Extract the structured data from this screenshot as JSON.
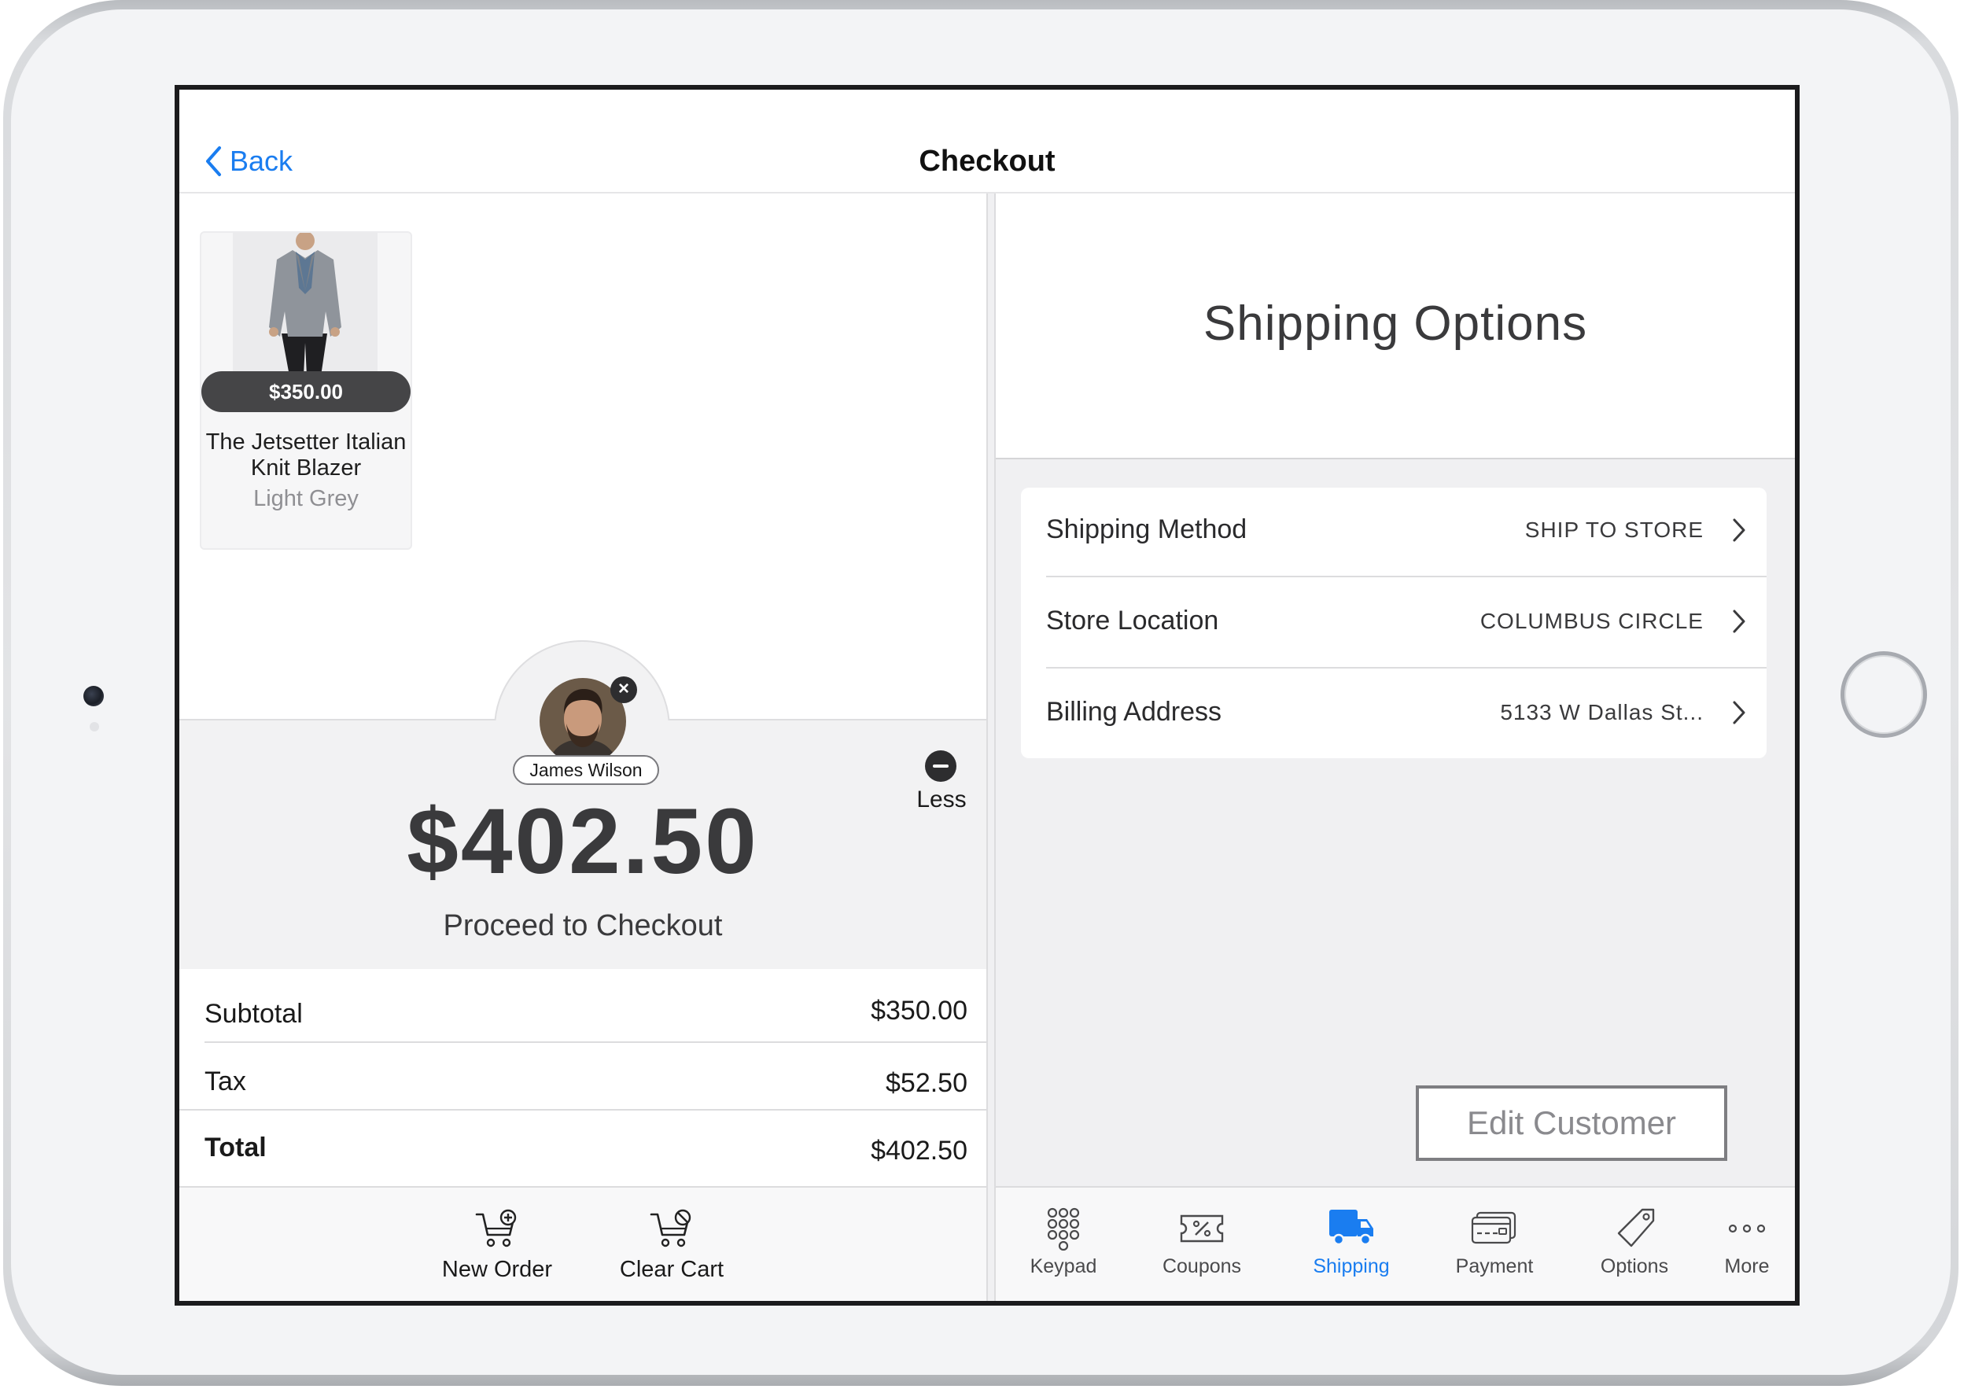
{
  "nav": {
    "back_label": "Back",
    "title": "Checkout"
  },
  "cart": {
    "items": [
      {
        "price": "$350.00",
        "name": "The Jetsetter Italian Knit Blazer",
        "variant": "Light Grey"
      }
    ]
  },
  "customer": {
    "name": "James Wilson"
  },
  "checkout": {
    "less_label": "Less",
    "total": "$402.50",
    "proceed_label": "Proceed to Checkout"
  },
  "summary": {
    "subtotal_label": "Subtotal",
    "subtotal_value": "$350.00",
    "tax_label": "Tax",
    "tax_value": "$52.50",
    "total_label": "Total",
    "total_value": "$402.50"
  },
  "left_tabs": [
    {
      "label": "New Order",
      "icon": "cart-add-icon"
    },
    {
      "label": "Clear Cart",
      "icon": "cart-clear-icon"
    }
  ],
  "shipping": {
    "title": "Shipping Options",
    "rows": [
      {
        "label": "Shipping Method",
        "value": "SHIP TO STORE"
      },
      {
        "label": "Store Location",
        "value": "COLUMBUS CIRCLE"
      },
      {
        "label": "Billing Address",
        "value": "5133 W Dallas St..."
      }
    ],
    "edit_customer_label": "Edit Customer"
  },
  "right_tabs": [
    {
      "label": "Keypad",
      "icon": "keypad-icon"
    },
    {
      "label": "Coupons",
      "icon": "coupon-icon"
    },
    {
      "label": "Shipping",
      "icon": "truck-icon",
      "active": true
    },
    {
      "label": "Payment",
      "icon": "payment-card-icon"
    },
    {
      "label": "Options",
      "icon": "tag-icon"
    },
    {
      "label": "More",
      "icon": "more-dots-icon"
    }
  ],
  "colors": {
    "accent": "#1a7df0",
    "text_dark": "#3a3a3c",
    "price_pill": "#454547",
    "panel_gray": "#f2f2f3"
  }
}
